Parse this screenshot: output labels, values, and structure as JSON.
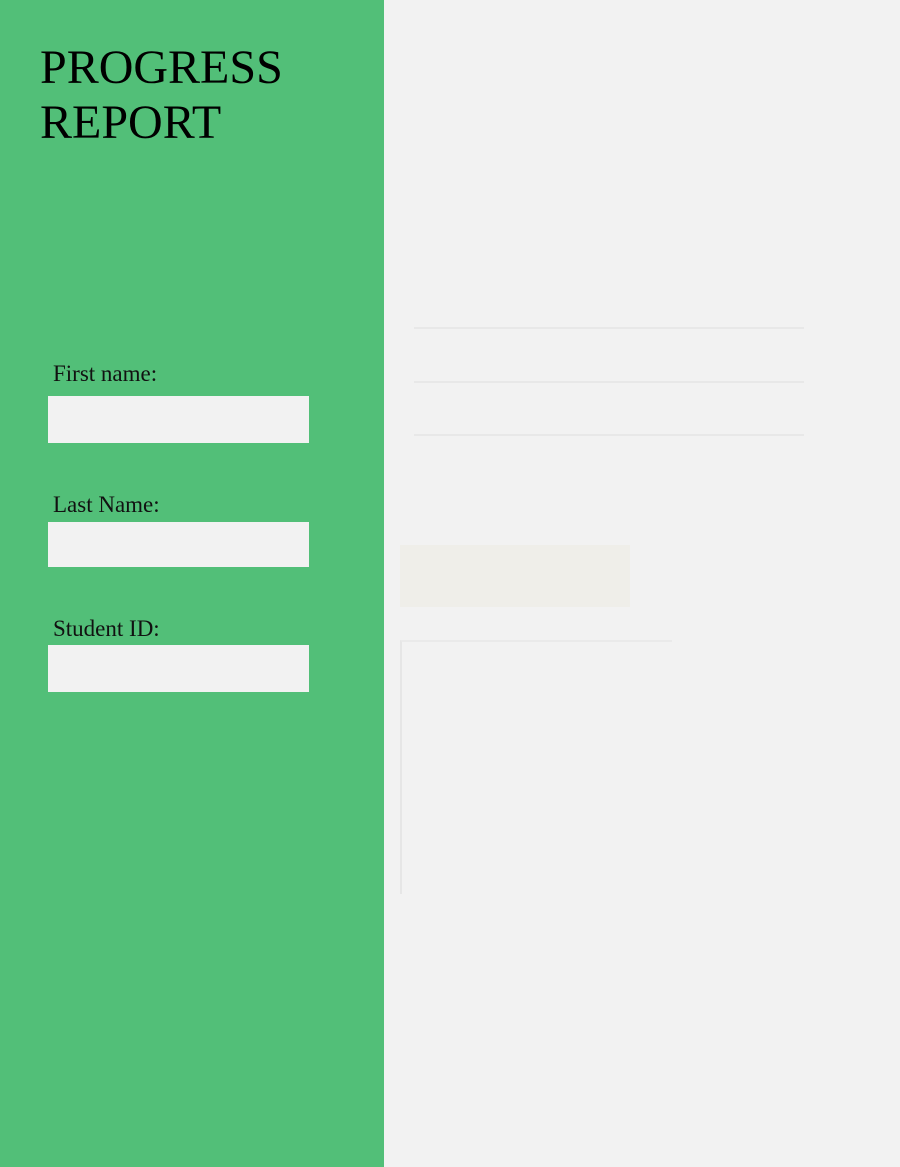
{
  "sidebar": {
    "title_line1": "PROGRESS",
    "title_line2": "REPORT",
    "fields": [
      {
        "label": "First name:",
        "value": ""
      },
      {
        "label": "Last Name:",
        "value": ""
      },
      {
        "label": "Student ID:",
        "value": ""
      }
    ]
  },
  "colors": {
    "sidebar_background": "#52bf78",
    "page_background": "#f2f2f2"
  }
}
